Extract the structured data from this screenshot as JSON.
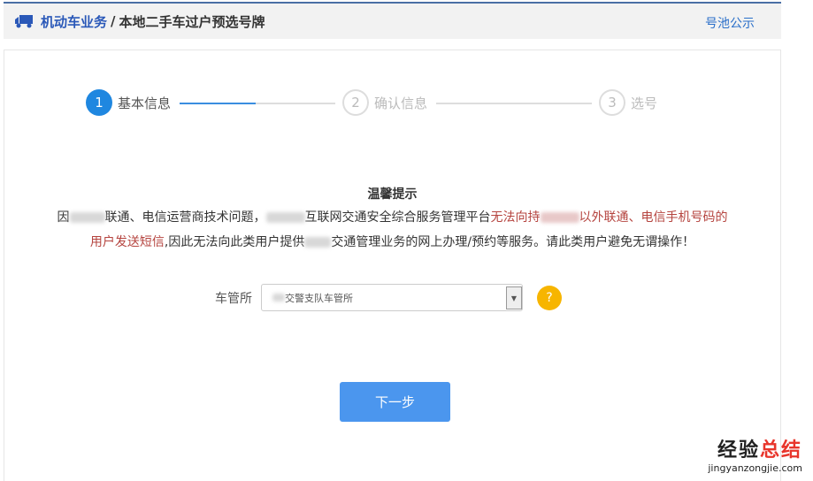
{
  "header": {
    "category": "机动车业务",
    "separator": "/",
    "title": "本地二手车过户预选号牌",
    "link": "号池公示"
  },
  "steps": [
    {
      "num": "1",
      "label": "基本信息",
      "active": true
    },
    {
      "num": "2",
      "label": "确认信息",
      "active": false
    },
    {
      "num": "3",
      "label": "选号",
      "active": false
    }
  ],
  "notice": {
    "title": "温馨提示",
    "l1a": "因",
    "l1b": "联通、电信运营商技术问题，",
    "l1c": "互联网交通安全综合服务管理平台",
    "l1d": "无法向持",
    "l1e": "以外联通、电信手机号码的",
    "l2a": "用户发送短信",
    "l2b": ",因此无法向此类用户提供",
    "l2c": "交通管理业务的网上办理/预约等服务。请此类用户避免无谓操作！"
  },
  "form": {
    "label": "车管所",
    "value": "交警支队车管所",
    "help": "?"
  },
  "next_button": "下一步",
  "watermark": {
    "line1a": "经验",
    "line1b": "总结",
    "line2": "jingyanzongjie.com"
  },
  "colors": {
    "accent": "#1f87e0",
    "button": "#4b96ee",
    "warning": "#b5443f"
  }
}
